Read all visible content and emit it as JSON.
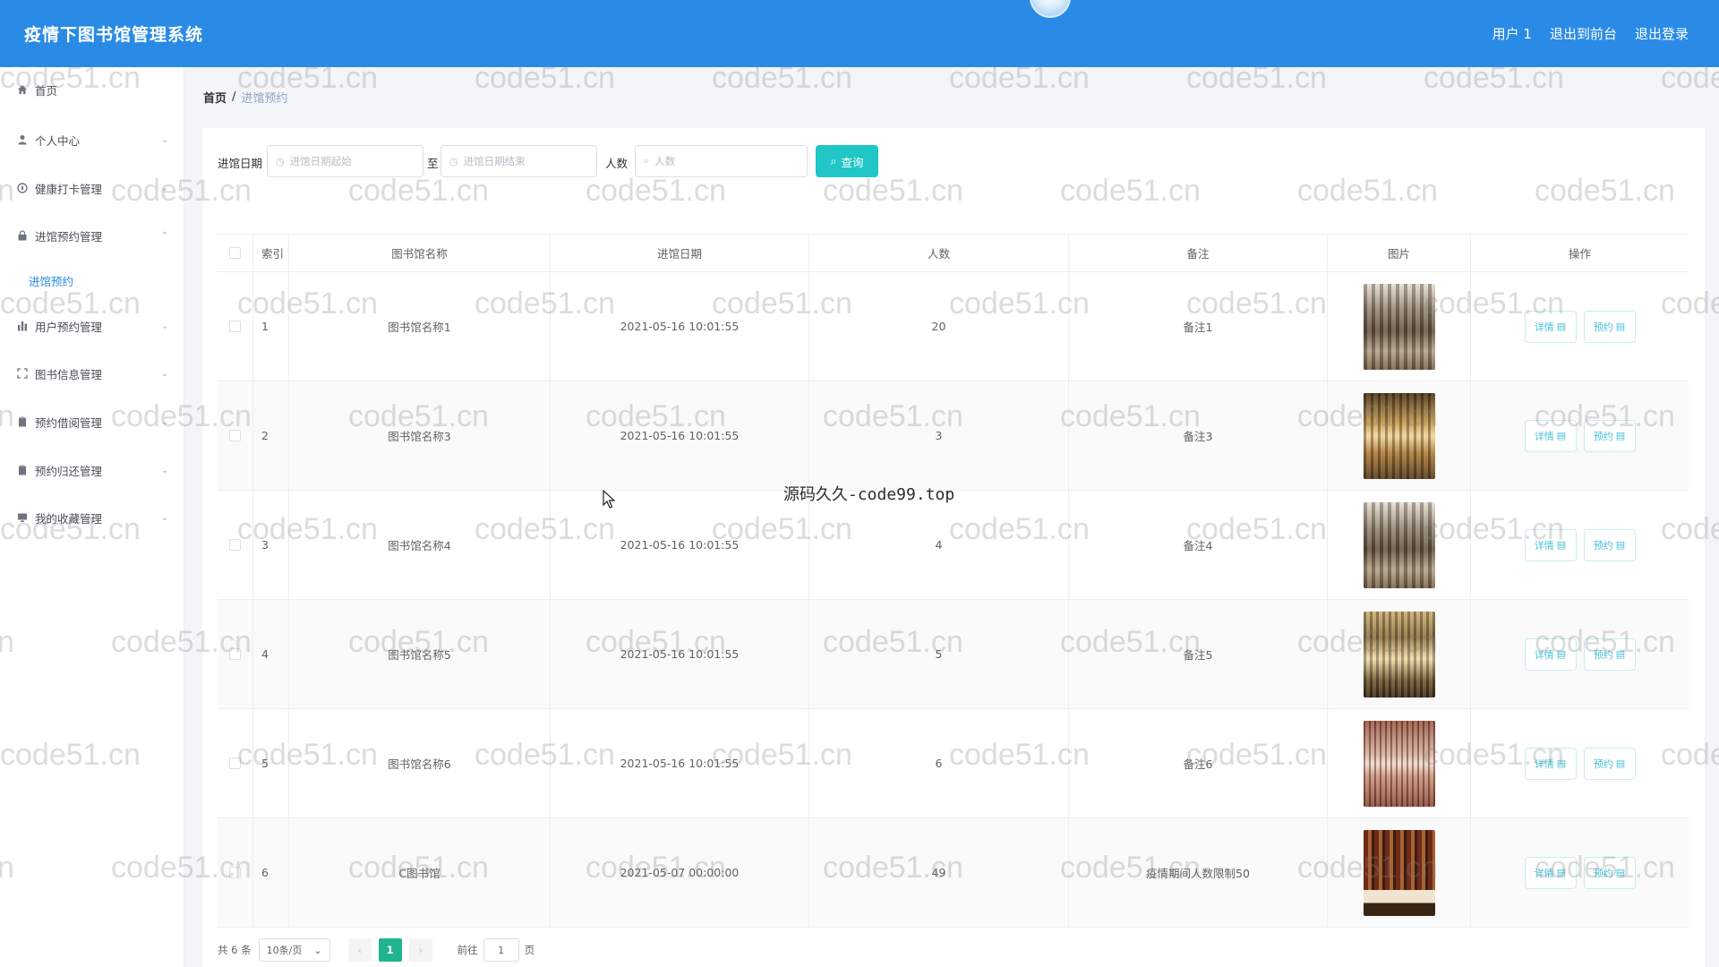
{
  "header": {
    "title": "疫情下图书馆管理系统",
    "links": [
      "用户 1",
      "退出到前台",
      "退出登录"
    ]
  },
  "sidebar": {
    "items": [
      {
        "label": "首页",
        "icon": "home-icon",
        "chevron": false
      },
      {
        "label": "个人中心",
        "icon": "user-icon",
        "chevron": true
      },
      {
        "label": "健康打卡管理",
        "icon": "compass-icon",
        "chevron": true
      },
      {
        "label": "进馆预约管理",
        "icon": "lock-icon",
        "chevron": true,
        "expanded": true
      },
      {
        "label": "用户预约管理",
        "icon": "bar-chart-icon",
        "chevron": true
      },
      {
        "label": "图书信息管理",
        "icon": "fullscreen-icon",
        "chevron": true
      },
      {
        "label": "预约借阅管理",
        "icon": "clipboard-icon",
        "chevron": true
      },
      {
        "label": "预约归还管理",
        "icon": "clipboard-icon",
        "chevron": true
      },
      {
        "label": "我的收藏管理",
        "icon": "monitor-icon",
        "chevron": true
      }
    ],
    "subitem": "进馆预约"
  },
  "breadcrumb": {
    "home": "首页",
    "separator": "/",
    "current": "进馆预约"
  },
  "filters": {
    "date_label": "进馆日期",
    "date_start_placeholder": "进馆日期起始",
    "date_to": "至",
    "date_end_placeholder": "进馆日期结束",
    "people_label": "人数",
    "people_placeholder": "人数",
    "search_label": "查询"
  },
  "table": {
    "headers": [
      "索引",
      "图书馆名称",
      "进馆日期",
      "人数",
      "备注",
      "图片",
      "操作"
    ],
    "detail_label": "详情",
    "reserve_label": "预约",
    "rows": [
      {
        "index": "1",
        "name": "图书馆名称1",
        "date": "2021-05-16 10:01:55",
        "people": "20",
        "remark": "备注1",
        "image": "library-shelves-photo"
      },
      {
        "index": "2",
        "name": "图书馆名称3",
        "date": "2021-05-16 10:01:55",
        "people": "3",
        "remark": "备注3",
        "image": "library-warm-aisle-photo"
      },
      {
        "index": "3",
        "name": "图书馆名称4",
        "date": "2021-05-16 10:01:55",
        "people": "4",
        "remark": "备注4",
        "image": "library-shelves-photo"
      },
      {
        "index": "4",
        "name": "图书馆名称5",
        "date": "2021-05-16 10:01:55",
        "people": "5",
        "remark": "备注5",
        "image": "library-atrium-photo"
      },
      {
        "index": "5",
        "name": "图书馆名称6",
        "date": "2021-05-16 10:01:55",
        "people": "6",
        "remark": "备注6",
        "image": "library-corridor-photo"
      },
      {
        "index": "6",
        "name": "C图书馆",
        "date": "2021-05-07 00:00:00",
        "people": "49",
        "remark": "疫情期间人数限制50",
        "image": "bookcase-open-book-photo"
      }
    ]
  },
  "pagination": {
    "total": "共 6 条",
    "page_size": "10条/页",
    "current_page": "1",
    "goto_prefix": "前往",
    "goto_value": "1",
    "goto_suffix": "页"
  },
  "watermark": {
    "text": "code51.cn",
    "center_text": "源码久久-code99.top"
  },
  "colors": {
    "header_bg": "#2a8be6",
    "accent": "#21c6c6",
    "active_page": "#21b58f",
    "submenu_active": "#2a8be6"
  }
}
